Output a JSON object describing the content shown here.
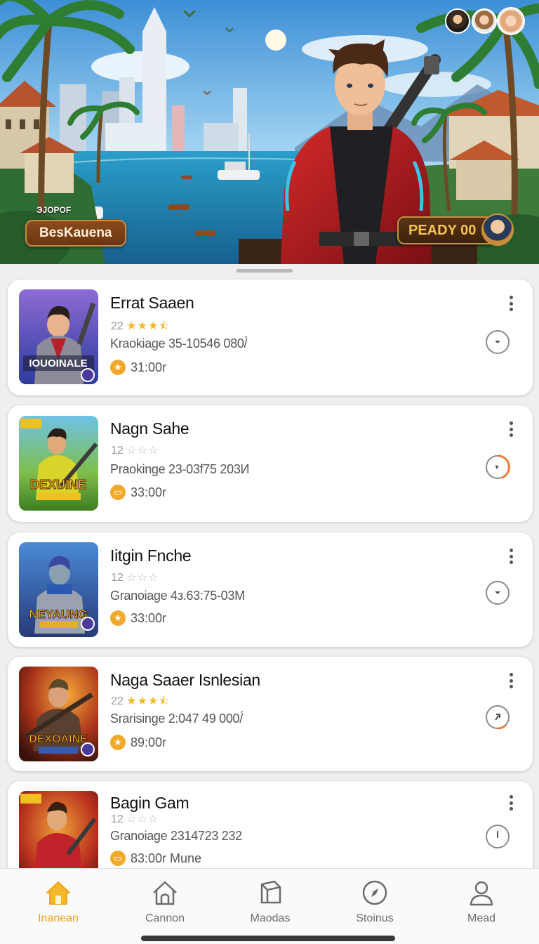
{
  "hero": {
    "small_text": "ЭJOPOF",
    "left_badge": "BesKauena",
    "right_badge": "PEADY 00"
  },
  "games": [
    {
      "title": "Errat Saaen",
      "rating_prefix": "22",
      "stars_on": 3,
      "stars_text_on": "★★★",
      "stars_text_off": "",
      "meta": "Kraokiage 35-10546 080/́",
      "price": "31:00r",
      "thumb_text": "IOUOINALE",
      "download_icon": "chevron-circle-icon",
      "accent": "#9a9a9a"
    },
    {
      "title": "Nagn Sahe",
      "rating_prefix": "12",
      "stars_on": 0,
      "stars_text_on": "",
      "stars_text_off": "☆☆☆",
      "meta": "Praokinge 23-03f75 203И",
      "price": "33:00r",
      "thumb_text": "DEXUINE",
      "download_icon": "progress-circle-icon",
      "accent": "#f07b39"
    },
    {
      "title": "Iitgin Fnche",
      "rating_prefix": "12",
      "stars_on": 0,
      "stars_text_on": "",
      "stars_text_off": "☆☆☆",
      "meta": "Granoiage 4з.63:75-03М",
      "price": "33:00r",
      "thumb_text": "NEYAUNG",
      "download_icon": "chevron-circle-icon",
      "accent": "#9a9a9a"
    },
    {
      "title": "Naga Saaer Isnlesian",
      "rating_prefix": "22",
      "stars_on": 3,
      "stars_text_on": "★★★",
      "stars_text_off": "",
      "meta": "Srarisinge 2:047 49 000/́",
      "price": "89:00r",
      "thumb_text": "DEXOAINE",
      "download_icon": "progress-circle-icon",
      "accent": "#f07b39"
    },
    {
      "title": "Bagin Gam",
      "rating_prefix": "12",
      "stars_on": 0,
      "stars_text_on": "",
      "stars_text_off": "☆☆☆",
      "meta": "Granoiage 2314723 232",
      "price": "83:00r Mune",
      "thumb_text": "",
      "download_icon": "clock-circle-icon",
      "accent": "#9a9a9a"
    }
  ],
  "nav": [
    {
      "label": "Inanean",
      "icon": "home-icon",
      "active": true
    },
    {
      "label": "Cannon",
      "icon": "house-outline-icon",
      "active": false
    },
    {
      "label": "Maodas",
      "icon": "box-icon",
      "active": false
    },
    {
      "label": "Stoinus",
      "icon": "compass-icon",
      "active": false
    },
    {
      "label": "Mead",
      "icon": "person-icon",
      "active": false
    }
  ],
  "colors": {
    "accent": "#f0a21c",
    "star": "#f2b821",
    "progress": "#f07b39"
  }
}
